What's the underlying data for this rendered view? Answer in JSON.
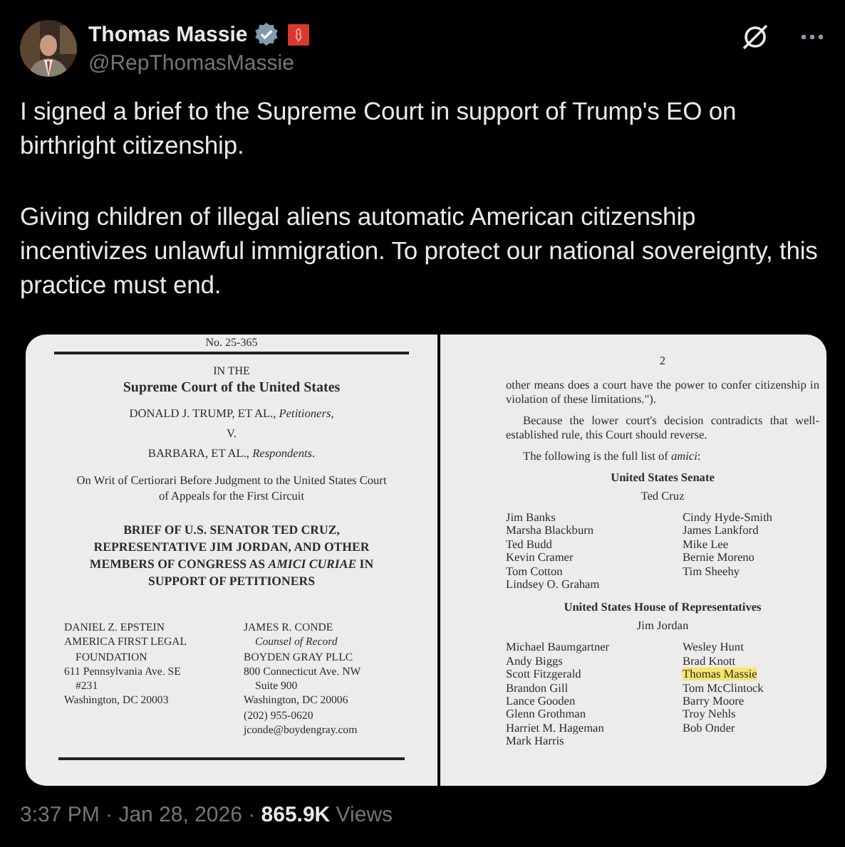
{
  "author": {
    "name": "Thomas Massie",
    "handle": "@RepThomasMassie",
    "verified": true
  },
  "post": {
    "paragraphs": [
      "I signed a brief to the Supreme Court in support of Trump's EO on birthright citizenship.",
      "Giving children of illegal aliens automatic American citizenship incentivizes unlawful immigration. To protect our national sovereignty, this practice must end."
    ]
  },
  "document": {
    "cover": {
      "docket": "No. 25-365",
      "court_intro": "IN THE",
      "court": "Supreme Court of the United States",
      "parties": [
        "DONALD J. TRUMP, ET AL., *Petitioners*,",
        "V.",
        "BARBARA, ET AL., *Respondents*."
      ],
      "writ": "On Writ of Certiorari Before Judgment to the United States Court of Appeals for the First Circuit",
      "brief_title": "BRIEF OF U.S. SENATOR TED CRUZ, REPRESENTATIVE JIM JORDAN, AND OTHER MEMBERS OF CONGRESS AS *AMICI CURIAE* IN SUPPORT OF PETITIONERS",
      "counsel": [
        {
          "lines": [
            {
              "text": "DANIEL Z. EPSTEIN",
              "indent": false
            },
            {
              "text": "AMERICA FIRST LEGAL",
              "indent": false
            },
            {
              "text": "FOUNDATION",
              "indent": true
            },
            {
              "text": "611 Pennsylvania Ave. SE",
              "indent": false
            },
            {
              "text": "#231",
              "indent": true
            },
            {
              "text": "Washington, DC 20003",
              "indent": false
            }
          ]
        },
        {
          "lines": [
            {
              "text": "JAMES R. CONDE",
              "indent": false
            },
            {
              "text": "*Counsel of Record*",
              "indent": true
            },
            {
              "text": "BOYDEN GRAY PLLC",
              "indent": false
            },
            {
              "text": "800 Connecticut Ave. NW",
              "indent": false
            },
            {
              "text": "Suite 900",
              "indent": true
            },
            {
              "text": "Washington, DC 20006",
              "indent": false
            },
            {
              "text": "(202) 955-0620",
              "indent": false
            },
            {
              "text": "jconde@boydengray.com",
              "indent": false
            }
          ]
        }
      ]
    },
    "page_two": {
      "page_number": "2",
      "paragraphs": [
        {
          "text": "other means does a court have the power to confer citizenship in violation of these limitations.\").",
          "indent": false
        },
        {
          "text": "Because the lower court's decision contradicts that well-established rule, this Court should reverse.",
          "indent": true
        },
        {
          "text": "The following is the full list of *amici*:",
          "indent": true
        }
      ],
      "sections": [
        {
          "heading": "United States Senate",
          "lead": "Ted Cruz",
          "members": [
            [
              {
                "name": "Jim Banks",
                "highlighted": false
              },
              {
                "name": "Marsha Blackburn",
                "highlighted": false
              },
              {
                "name": "Ted Budd",
                "highlighted": false
              },
              {
                "name": "Kevin Cramer",
                "highlighted": false
              },
              {
                "name": "Tom Cotton",
                "highlighted": false
              },
              {
                "name": "Lindsey O. Graham",
                "highlighted": false
              }
            ],
            [
              {
                "name": "Cindy Hyde-Smith",
                "highlighted": false
              },
              {
                "name": "James Lankford",
                "highlighted": false
              },
              {
                "name": "Mike Lee",
                "highlighted": false
              },
              {
                "name": "Bernie Moreno",
                "highlighted": false
              },
              {
                "name": "Tim Sheehy",
                "highlighted": false
              }
            ]
          ]
        },
        {
          "heading": "United States House of Representatives",
          "lead": "Jim Jordan",
          "members": [
            [
              {
                "name": "Michael Baumgartner",
                "highlighted": false
              },
              {
                "name": "Andy Biggs",
                "highlighted": false
              },
              {
                "name": "Scott Fitzgerald",
                "highlighted": false
              },
              {
                "name": "Brandon Gill",
                "highlighted": false
              },
              {
                "name": "Lance Gooden",
                "highlighted": false
              },
              {
                "name": "Glenn Grothman",
                "highlighted": false
              },
              {
                "name": "Harriet M. Hageman",
                "highlighted": false
              },
              {
                "name": "Mark Harris",
                "highlighted": false
              }
            ],
            [
              {
                "name": "Wesley Hunt",
                "highlighted": false
              },
              {
                "name": "Brad Knott",
                "highlighted": false
              },
              {
                "name": "Thomas Massie",
                "highlighted": true
              },
              {
                "name": "Tom McClintock",
                "highlighted": false
              },
              {
                "name": "Barry Moore",
                "highlighted": false
              },
              {
                "name": "Troy Nehls",
                "highlighted": false
              },
              {
                "name": "Bob Onder",
                "highlighted": false
              }
            ]
          ]
        }
      ]
    }
  },
  "meta": "3:37 PM · Jan 28, 2026 · **865.9K** Views"
}
